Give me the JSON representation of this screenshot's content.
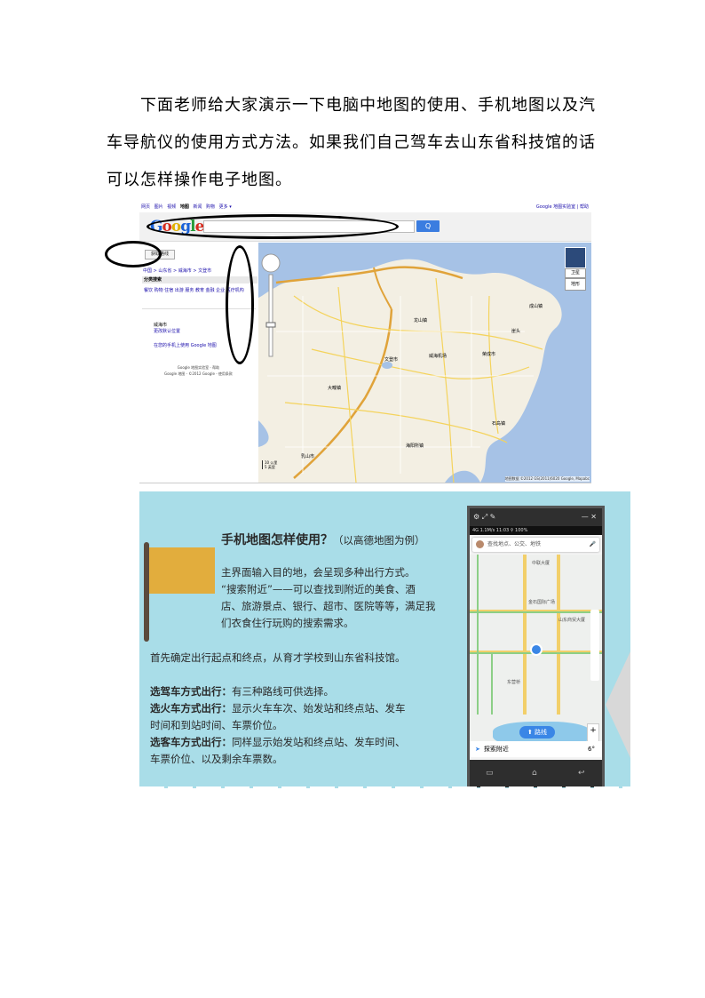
{
  "doc": {
    "para1": "下面老师给大家演示一下电脑中地图的使用、手机地图以及汽",
    "para2": "车导航仪的使用方式方法。如果我们自己驾车去山东省科技馆的话",
    "para3": "可以怎样操作电子地图。"
  },
  "google": {
    "nav": [
      "网页",
      "图片",
      "视频",
      "地图",
      "新闻",
      "购物",
      "更多 ▾"
    ],
    "nav_current": "地图",
    "top_right": "Google 地图实验室 | 帮助",
    "logo_letters": [
      "G",
      "o",
      "o",
      "g",
      "l",
      "e"
    ],
    "search_button": "Q",
    "route_button": "获取路线",
    "breadcrumb": "中国 > 山东省 > 威海市 > 文登市",
    "category_header": "分类搜索",
    "categories": "餐饮 购物 住宿 出游 服务 教育 金融 企业 医疗机构",
    "city_name": "威海市",
    "city_link": "更改默认位置",
    "mobile_link": "在您的手机上使用 Google 地图",
    "footer_line1": "Google 地图实验室 - 帮助",
    "footer_line2": "Google 地图 - ©2012 Google - 使用条款",
    "sat_label": "卫星",
    "map_label": "地形",
    "scale1": "10 公里",
    "scale2": "5 英里",
    "copyright": "地图数据 ©2012 GS(2011)6020 Google, Mapabc",
    "map_places": [
      {
        "name": "文登市"
      },
      {
        "name": "乳山市"
      },
      {
        "name": "荣成市"
      },
      {
        "name": "威海机场"
      },
      {
        "name": "石岛镇"
      },
      {
        "name": "海阳所镇"
      },
      {
        "name": "龙山镇"
      },
      {
        "name": "崖头"
      },
      {
        "name": "成山镇"
      },
      {
        "name": "大疃镇"
      }
    ]
  },
  "slide": {
    "title": "手机地图怎样使用？",
    "title_note": "（以高德地图为例）",
    "intro1": "主界面输入目的地，会呈现多种出行方式。",
    "intro2": "“搜索附近”——可以查找到附近的美食、酒",
    "intro3": "店、旅游景点、银行、超市、医院等等，满足我",
    "intro4": "们衣食住行玩购的搜索需求。",
    "step": "首先确定出行起点和终点，从育才学校到山东省科技馆。",
    "car_label": "选驾车方式出行：",
    "car_text": "有三种路线可供选择。",
    "train_label": "选火车方式出行：",
    "train_text1": "显示火车车次、始发站和终点站、发车",
    "train_text2": "时间和到站时间、车票价位。",
    "bus_label": "选客车方式出行：",
    "bus_text1": "同样显示始发站和终点站、发车时间、",
    "bus_text2": "车票价位、以及剩余车票数。"
  },
  "phone": {
    "status": "4G 1.1M/s  11:03  ⚲  100%",
    "time": "11:03",
    "search_placeholder": "查找地点、公交、地铁",
    "route_button": "路线",
    "nearby": "探索附近",
    "temp": "6°",
    "place1": "中联大厦",
    "place2": "金石国际广场",
    "place3": "山东商贸大厦",
    "place4": "东营桥",
    "zoom_in": "+",
    "zoom_out": "−"
  }
}
